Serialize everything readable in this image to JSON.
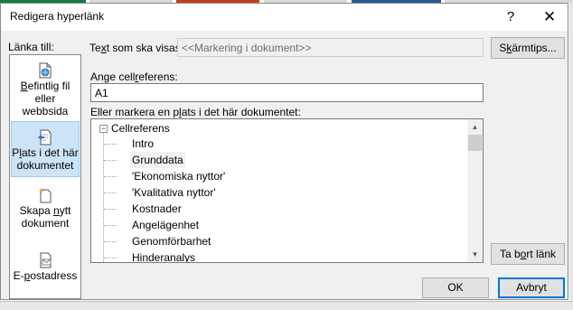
{
  "window": {
    "title": "Redigera hyperlänk",
    "help_glyph": "?",
    "close_glyph": "✕"
  },
  "link_to": {
    "label": "Länka till:",
    "items": [
      {
        "icon": "existing-file-icon",
        "label": "Befintlig fil eller webbsida",
        "selected": false
      },
      {
        "icon": "place-in-document-icon",
        "label": "Plats i det här dokumentet",
        "selected": true
      },
      {
        "icon": "create-new-document-icon",
        "label": "Skapa nytt dokument",
        "selected": false
      },
      {
        "icon": "email-icon",
        "label": "E-postadress",
        "selected": false
      }
    ]
  },
  "display_text": {
    "label": "Text som ska visas:",
    "value": "<<Markering i dokument>>"
  },
  "screentip_button": "Skärmtips...",
  "cell_reference": {
    "label": "Ange cellreferens:",
    "value": "A1"
  },
  "place_list": {
    "label": "Eller markera en plats i det här dokumentet:",
    "root": "Cellreferens",
    "expander_glyph": "−",
    "items": [
      "Intro",
      "Grunddata",
      "'Ekonomiska nyttor'",
      "'Kvalitativa nyttor'",
      "Kostnader",
      "Angelägenhet",
      "Genomförbarhet",
      "Hinderanalys"
    ],
    "selected_index": 1,
    "scroll_up_glyph": "▲",
    "scroll_down_glyph": "▼"
  },
  "remove_link_button": "Ta bort länk",
  "ok_button": "OK",
  "cancel_button": "Avbryt",
  "colors": {
    "dialog_bg": "#f0f0f0",
    "selection_bg": "#cce4f7",
    "default_button_border": "#0078d7",
    "background_strip": [
      "#21a366",
      "#ffffff",
      "#c43e1c",
      "#ffffff",
      "#2b579a",
      "#ffffff"
    ]
  }
}
